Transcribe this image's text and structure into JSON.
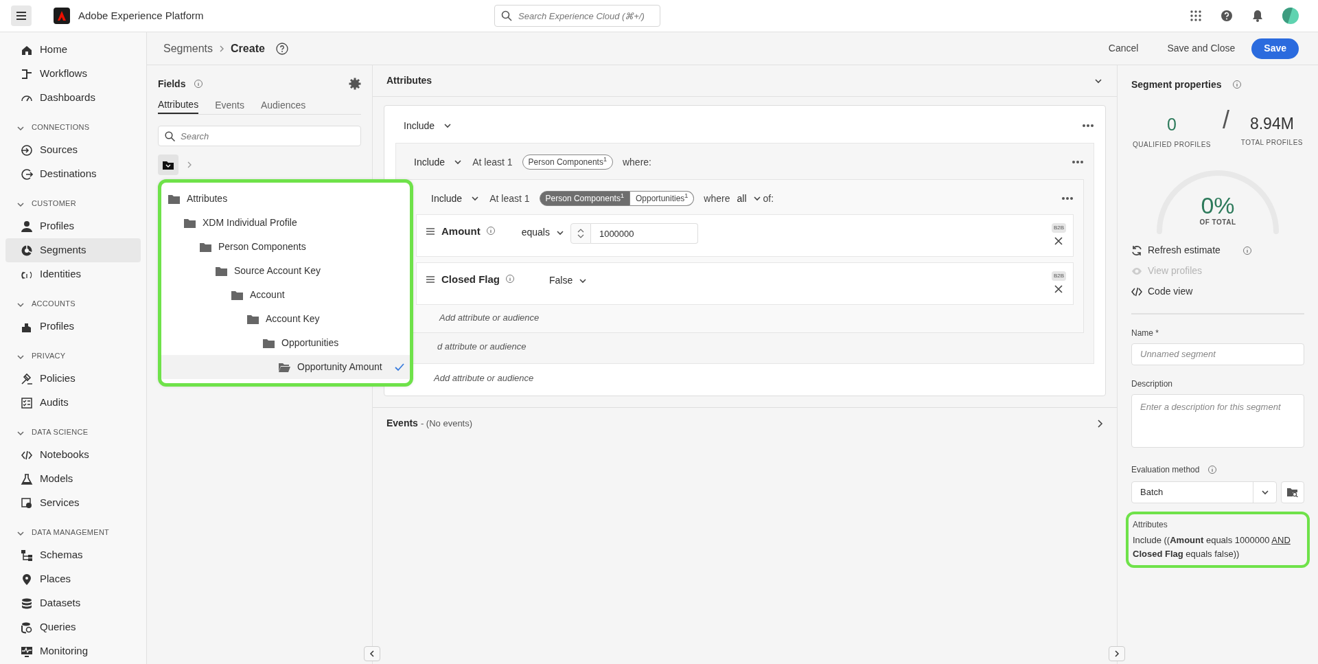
{
  "header": {
    "product": "Adobe Experience Platform",
    "search_placeholder": "Search Experience Cloud (⌘+/)"
  },
  "nav": [
    {
      "kind": "item",
      "label": "Home",
      "selected": false
    },
    {
      "kind": "item",
      "label": "Workflows",
      "selected": false
    },
    {
      "kind": "item",
      "label": "Dashboards",
      "selected": false
    },
    {
      "kind": "section",
      "label": "CONNECTIONS"
    },
    {
      "kind": "item",
      "label": "Sources",
      "selected": false
    },
    {
      "kind": "item",
      "label": "Destinations",
      "selected": false
    },
    {
      "kind": "section",
      "label": "CUSTOMER"
    },
    {
      "kind": "item",
      "label": "Profiles",
      "selected": false
    },
    {
      "kind": "item",
      "label": "Segments",
      "selected": true
    },
    {
      "kind": "item",
      "label": "Identities",
      "selected": false
    },
    {
      "kind": "section",
      "label": "ACCOUNTS"
    },
    {
      "kind": "item",
      "label": "Profiles",
      "selected": false
    },
    {
      "kind": "section",
      "label": "PRIVACY"
    },
    {
      "kind": "item",
      "label": "Policies",
      "selected": false
    },
    {
      "kind": "item",
      "label": "Audits",
      "selected": false
    },
    {
      "kind": "section",
      "label": "DATA SCIENCE"
    },
    {
      "kind": "item",
      "label": "Notebooks",
      "selected": false
    },
    {
      "kind": "item",
      "label": "Models",
      "selected": false
    },
    {
      "kind": "item",
      "label": "Services",
      "selected": false
    },
    {
      "kind": "section",
      "label": "DATA MANAGEMENT"
    },
    {
      "kind": "item",
      "label": "Schemas",
      "selected": false
    },
    {
      "kind": "item",
      "label": "Places",
      "selected": false
    },
    {
      "kind": "item",
      "label": "Datasets",
      "selected": false
    },
    {
      "kind": "item",
      "label": "Queries",
      "selected": false
    },
    {
      "kind": "item",
      "label": "Monitoring",
      "selected": false
    }
  ],
  "breadcrumb": [
    "Segments",
    "Create"
  ],
  "actions": {
    "cancel": "Cancel",
    "save_close": "Save and Close",
    "save": "Save"
  },
  "fields": {
    "title": "Fields",
    "tabs": [
      {
        "label": "Attributes",
        "selected": true
      },
      {
        "label": "Events",
        "selected": false
      },
      {
        "label": "Audiences",
        "selected": false
      }
    ],
    "search_placeholder": "Search",
    "tree": [
      {
        "label": "Attributes",
        "selected": false,
        "children": [
          {
            "label": "XDM Individual Profile",
            "selected": false,
            "children": [
              {
                "label": "Person Components",
                "selected": false,
                "children": [
                  {
                    "label": "Source Account Key",
                    "selected": false,
                    "children": [
                      {
                        "label": "Account",
                        "selected": false,
                        "children": [
                          {
                            "label": "Account Key",
                            "selected": false,
                            "children": [
                              {
                                "label": "Opportunities",
                                "selected": false,
                                "children": [
                                  {
                                    "label": "Opportunity Amount",
                                    "selected": true
                                  }
                                ]
                              }
                            ]
                          }
                        ]
                      }
                    ]
                  }
                ]
              }
            ]
          }
        ]
      }
    ]
  },
  "builder": {
    "title": "Attributes",
    "operator": "Include",
    "add": "Add attribute or audience",
    "group": {
      "operator": "Include",
      "quantifier": "At least 1",
      "chips": [
        {
          "label": "Person Components",
          "count": "1",
          "selected": false
        }
      ],
      "suffix": "where:",
      "add": "d attribute or audience",
      "group": {
        "operator": "Include",
        "quantifier": "At least 1",
        "chips": [
          {
            "label": "Person Components",
            "count": "1",
            "selected": true
          },
          {
            "label": "Opportunities",
            "count": "1",
            "selected": false
          }
        ],
        "where": "where",
        "match": "all",
        "suffix": "of:",
        "add": "Add attribute or audience",
        "conditions": [
          {
            "kind": "number",
            "name": "Amount",
            "operator": "equals",
            "value": "1000000",
            "badge": "B2B"
          },
          {
            "kind": "select",
            "name": "Closed Flag",
            "value": "False",
            "badge": "B2B"
          }
        ]
      }
    }
  },
  "events": {
    "title": "Events",
    "note": "- (No events)"
  },
  "properties": {
    "title": "Segment properties",
    "qualified": "0",
    "qualified_label": "QUALIFIED PROFILES",
    "slash": "/",
    "total": "8.94M",
    "total_label": "TOTAL PROFILES",
    "percent": "0%",
    "percent_label": "OF TOTAL",
    "links": [
      {
        "label": "Refresh estimate",
        "disabled": false,
        "info": true
      },
      {
        "label": "View profiles",
        "disabled": true,
        "info": false
      },
      {
        "label": "Code view",
        "disabled": false,
        "info": false
      }
    ],
    "name_label": "Name *",
    "name_placeholder": "Unnamed segment",
    "description_label": "Description",
    "description_placeholder": "Enter a description for this segment",
    "evaluation_label": "Evaluation method",
    "evaluation_value": "Batch",
    "summary_title": "Attributes",
    "summary_before": "Include ((**Amount** equals 1000000",
    "summary_mid": "AND",
    "summary_after": "**Closed Flag** equals false))"
  }
}
